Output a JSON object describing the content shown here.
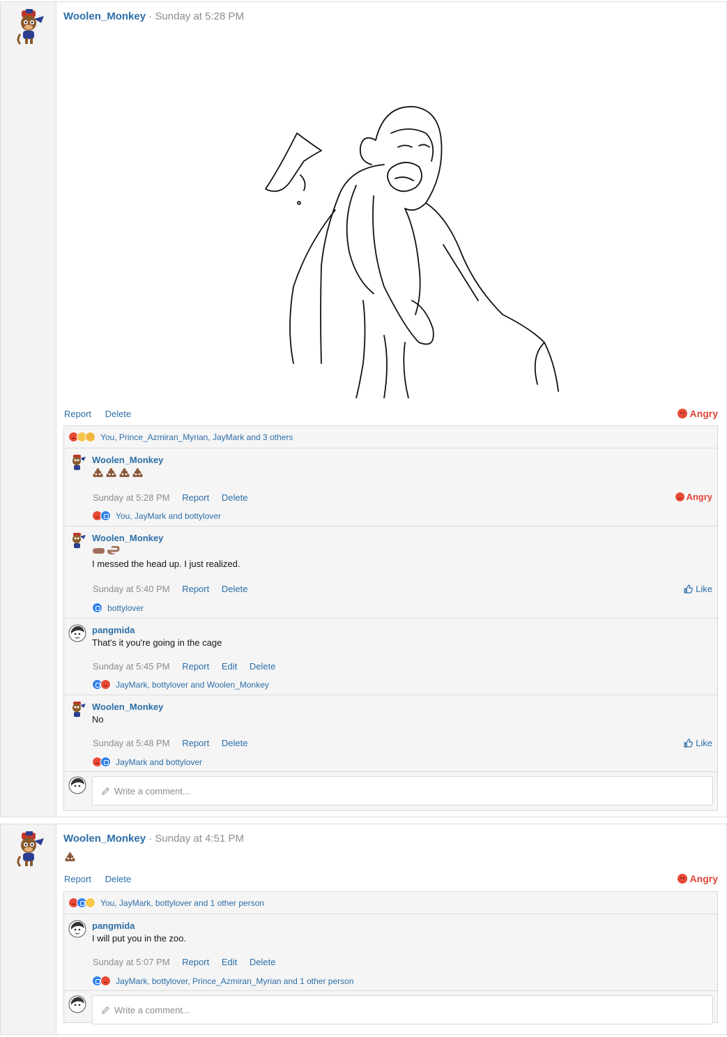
{
  "post1": {
    "author": "Woolen_Monkey",
    "time": "· Sunday at 5:28 PM",
    "actions": [
      "Report",
      "Delete"
    ],
    "reaction_label": "Angry",
    "reactions_summary": "You, Prince_Azmiran_Myrian, JayMark and 3 others",
    "comments": [
      {
        "author": "Woolen_Monkey",
        "body": "",
        "time": "Sunday at 5:28 PM",
        "actions": [
          "Report",
          "Delete"
        ],
        "reaction_label": "Angry",
        "reactions": "You, JayMark and bottylover"
      },
      {
        "author": "Woolen_Monkey",
        "body": "I messed the head up. I just realized.",
        "time": "Sunday at 5:40 PM",
        "actions": [
          "Report",
          "Delete"
        ],
        "reaction_label": "Like",
        "reactions": "bottylover"
      },
      {
        "author": "pangmida",
        "body": "That's it you're going in the cage",
        "time": "Sunday at 5:45 PM",
        "actions": [
          "Report",
          "Edit",
          "Delete"
        ],
        "reactions": "JayMark, bottylover and Woolen_Monkey"
      },
      {
        "author": "Woolen_Monkey",
        "body": "No",
        "time": "Sunday at 5:48 PM",
        "actions": [
          "Report",
          "Delete"
        ],
        "reaction_label": "Like",
        "reactions": "JayMark and bottylover"
      }
    ],
    "write_placeholder": "Write a comment..."
  },
  "post2": {
    "author": "Woolen_Monkey",
    "time": "· Sunday at 4:51 PM",
    "actions": [
      "Report",
      "Delete"
    ],
    "reaction_label": "Angry",
    "reactions_summary": "You, JayMark, bottylover and 1 other person",
    "comments": [
      {
        "author": "pangmida",
        "body": "I will put you in the zoo.",
        "time": "Sunday at 5:07 PM",
        "actions": [
          "Report",
          "Edit",
          "Delete"
        ],
        "reactions": "JayMark, bottylover, Prince_Azmiran_Myrian and 1 other person"
      }
    ],
    "write_placeholder": "Write a comment..."
  },
  "colors": {
    "link": "#2c6ea8",
    "angry": "#e0453a",
    "meta": "#8c8c8c"
  },
  "icons": [
    "monkey-avatar-icon",
    "pangmida-avatar-icon",
    "angry-emoji-icon",
    "like-icon",
    "poop-emoji-icon",
    "pencil-icon",
    "thumbs-up-icon"
  ]
}
